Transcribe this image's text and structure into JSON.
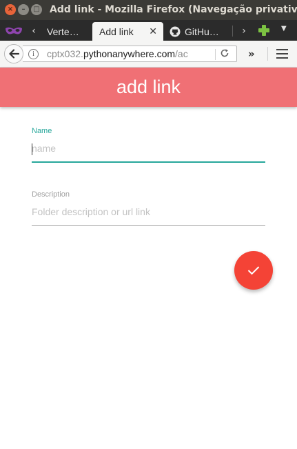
{
  "window": {
    "title": "Add link - Mozilla Firefox (Navegação privativa)"
  },
  "tabs": [
    {
      "label": "Verte…",
      "active": false
    },
    {
      "label": "Add link",
      "active": true
    },
    {
      "label": "GitHu…",
      "active": false
    }
  ],
  "navbar": {
    "url_prefix": "cptx032.",
    "url_domain": "pythonanywhere.com",
    "url_suffix": "/ac"
  },
  "icons": {
    "private_browsing": "mask-icon",
    "back": "back-arrow-icon",
    "info": "info-icon",
    "reload": "reload-icon",
    "overflow": "double-chevron-icon",
    "menu": "hamburger-icon",
    "addon": "green-plus-icon",
    "submit": "checkmark-icon"
  },
  "header": {
    "title": "add link"
  },
  "form": {
    "name": {
      "label": "Name",
      "placeholder": "name",
      "value": ""
    },
    "description": {
      "label": "Description",
      "placeholder": "Folder description or url link",
      "value": ""
    }
  },
  "colors": {
    "header_bg": "#f07075",
    "accent": "#26a69a",
    "fab": "#f44336"
  }
}
